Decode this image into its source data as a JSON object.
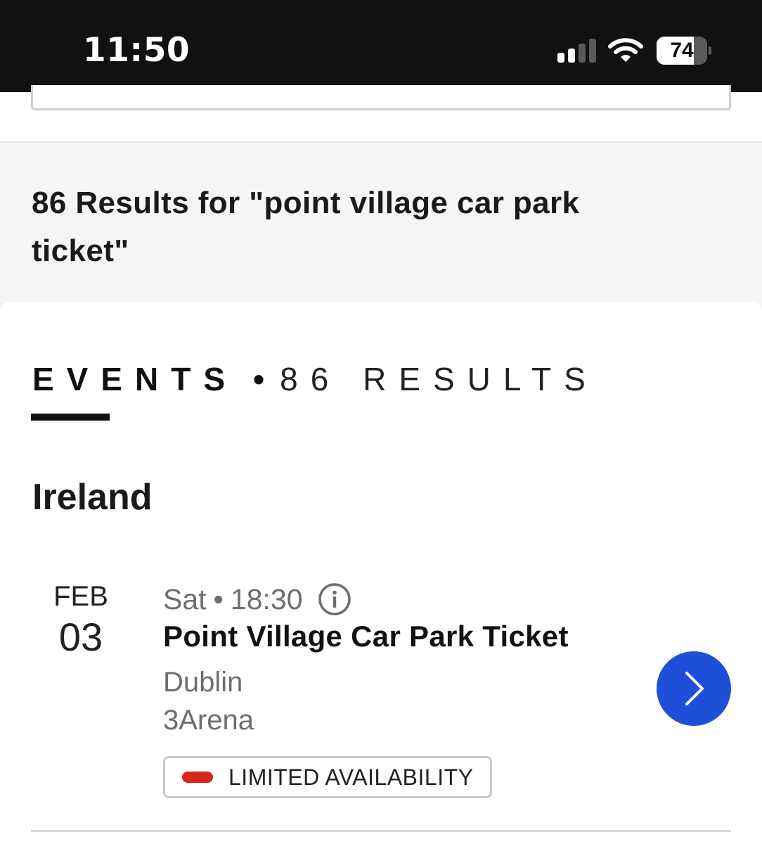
{
  "status_bar": {
    "time": "11:50",
    "battery_level": "74",
    "battery_fraction": 0.74,
    "signal_bars_active": 2,
    "signal_bars_total": 4,
    "icons": [
      "signal-icon",
      "wifi-icon",
      "battery-icon"
    ]
  },
  "results": {
    "title": "86 Results for \"point village car park ticket\""
  },
  "tabs": {
    "events_label": "EVENTS",
    "separator": "•",
    "count_label": "86 RESULTS"
  },
  "section": {
    "title": "Ireland"
  },
  "event": {
    "month": "FEB",
    "day": "03",
    "weekday": "Sat",
    "meta_separator": "•",
    "time": "18:30",
    "title": "Point Village Car Park Ticket",
    "city": "Dublin",
    "venue": "3Arena",
    "availability": "LIMITED AVAILABILITY",
    "info_icon": "info-icon",
    "next_icon": "chevron-right-icon"
  },
  "colors": {
    "status_bar_bg": "#111111",
    "accent_blue": "#1f4fd8",
    "availability_red": "#d9261c",
    "header_bg": "#f5f5f5",
    "muted_text": "#6e6e6e"
  }
}
